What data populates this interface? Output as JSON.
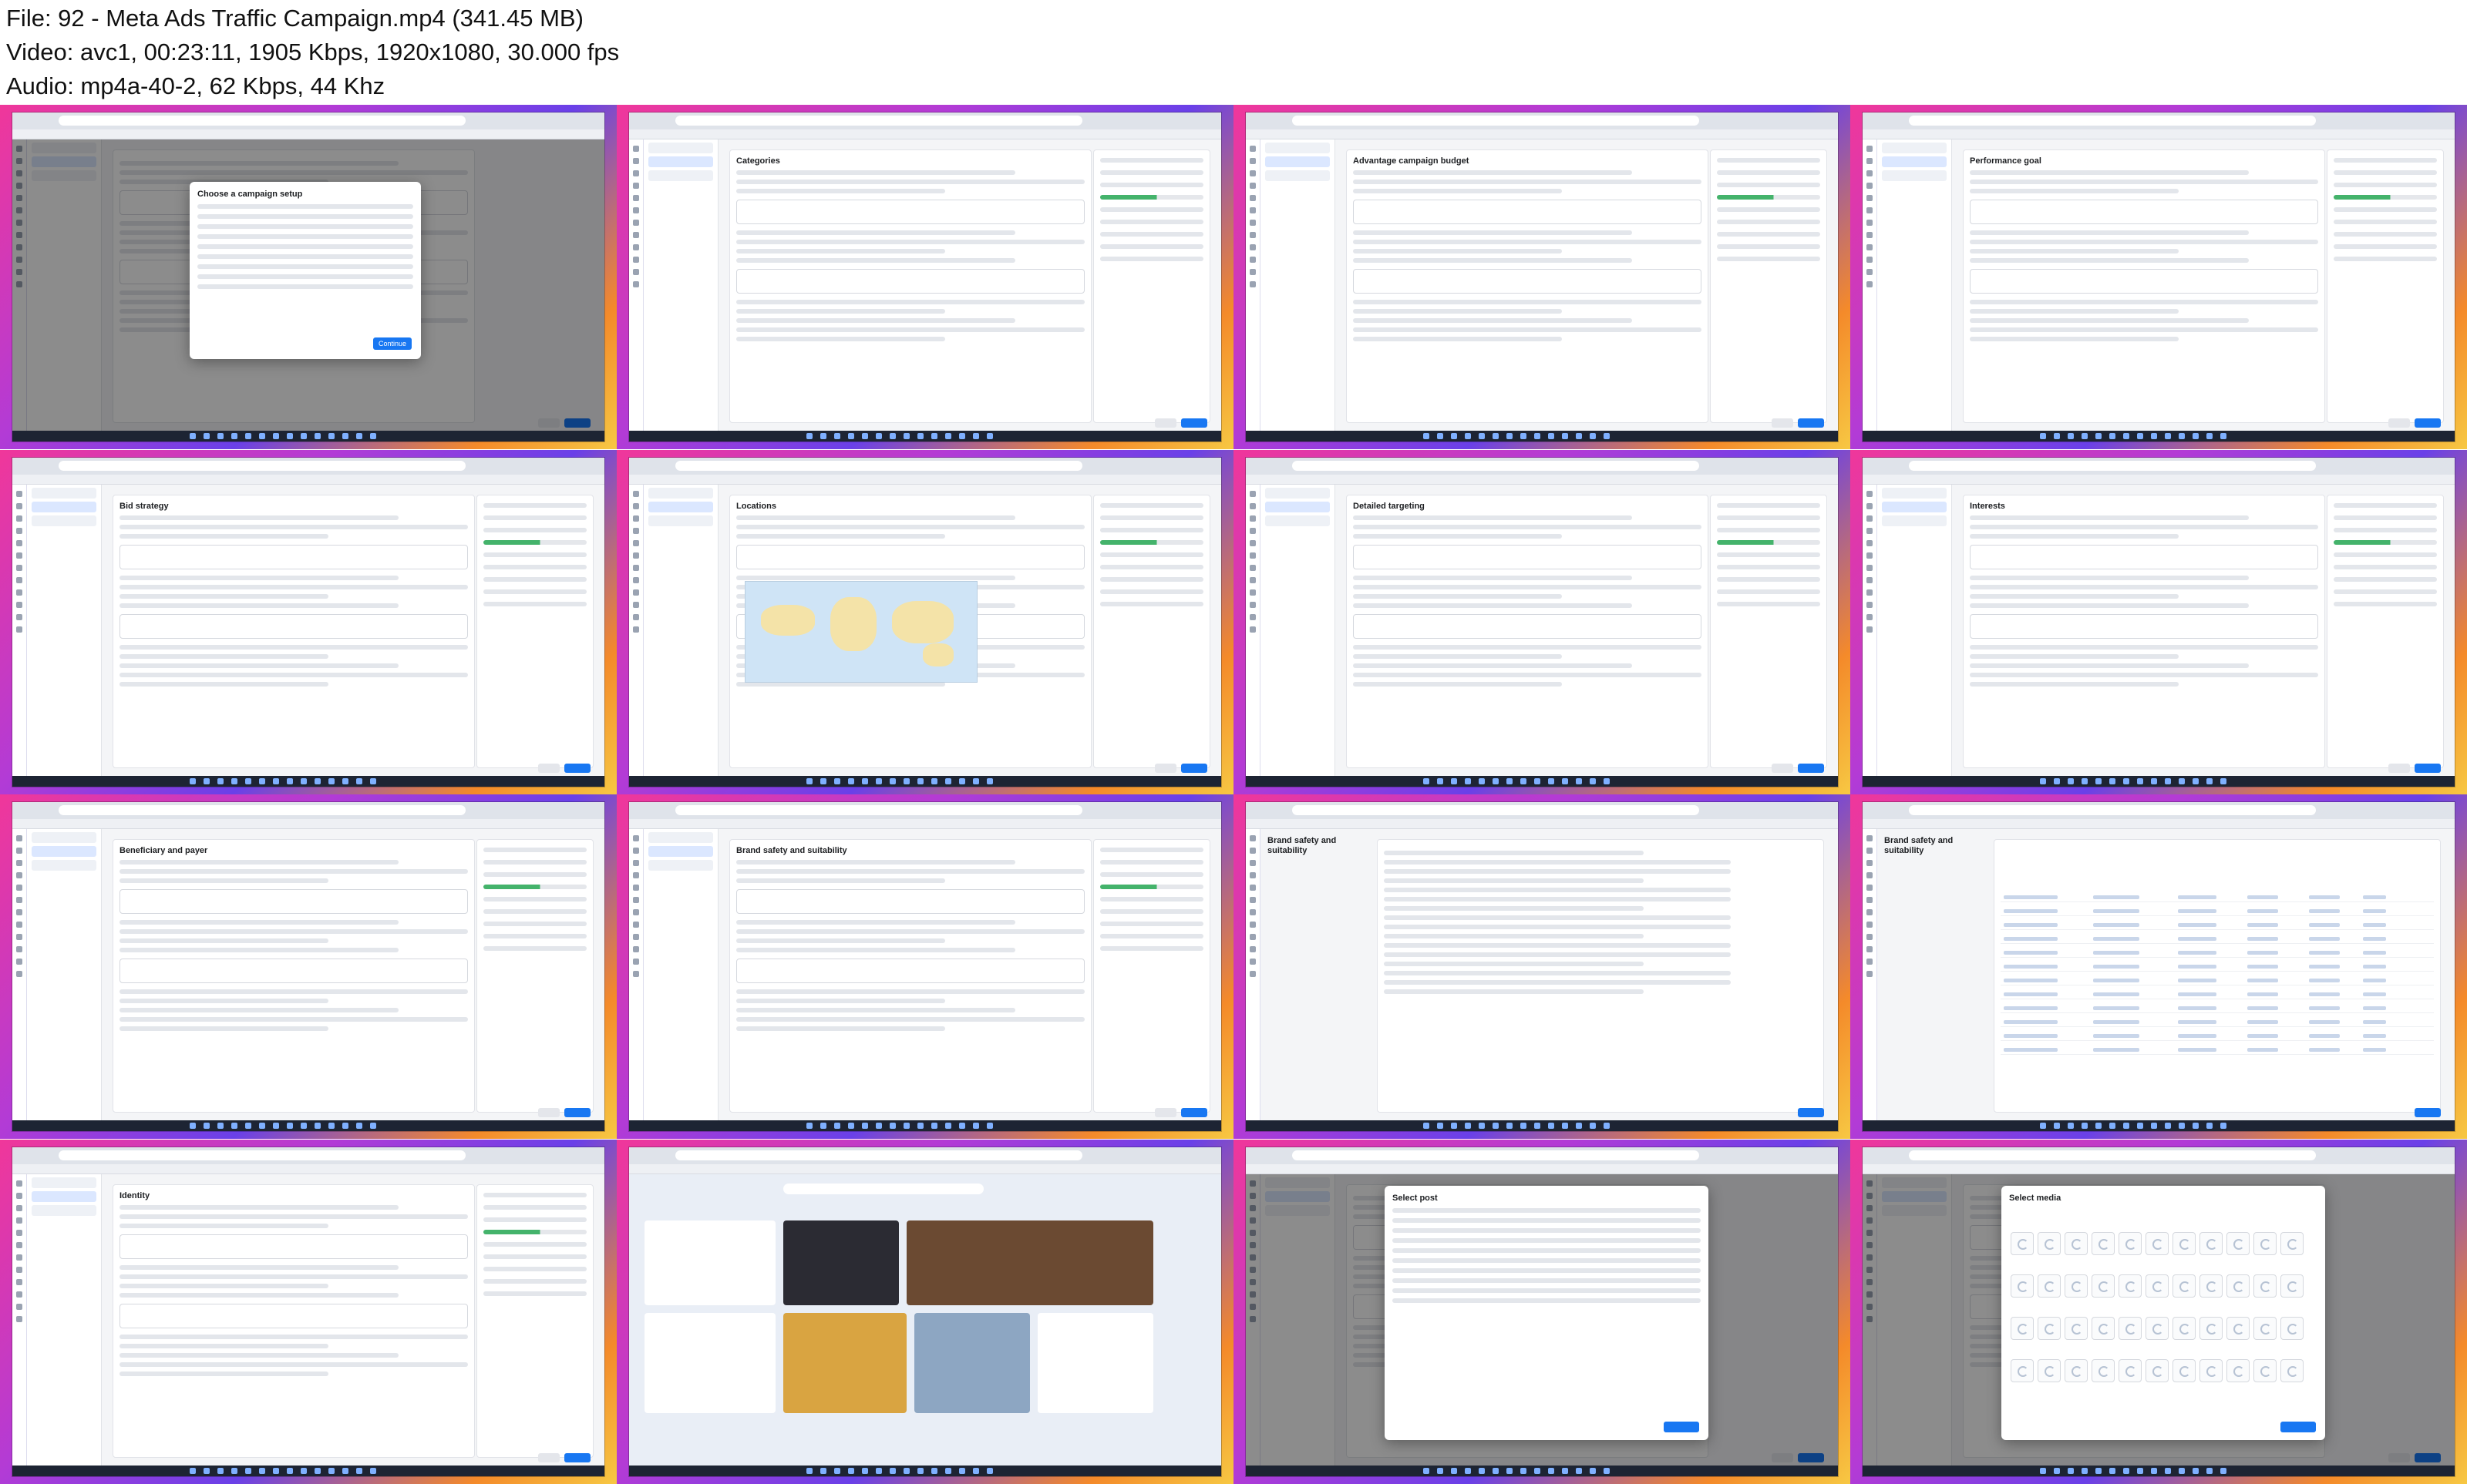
{
  "header": {
    "file_line": "File: 92 - Meta Ads Traffic Campaign.mp4 (341.45 MB)",
    "video_line": "Video: avc1, 00:23:11, 1905 Kbps, 1920x1080, 30.000 fps",
    "audio_line": "Audio: mp4a-40-2, 62 Kbps, 44 Khz"
  },
  "frames": [
    {
      "id": 1,
      "scene": "choose-campaign-setup-modal",
      "modal_title": "Choose a campaign setup",
      "primary_button": "Continue"
    },
    {
      "id": 2,
      "scene": "categories-dropdown",
      "section_title": "Categories"
    },
    {
      "id": 3,
      "scene": "advantage-campaign-budget",
      "section_title": "Advantage campaign budget"
    },
    {
      "id": 4,
      "scene": "performance-goal",
      "section_title": "Performance goal"
    },
    {
      "id": 5,
      "scene": "bid-strategy",
      "section_title": "Bid strategy"
    },
    {
      "id": 6,
      "scene": "locations-map",
      "section_title": "Locations"
    },
    {
      "id": 7,
      "scene": "detailed-targeting",
      "section_title": "Detailed targeting"
    },
    {
      "id": 8,
      "scene": "interests-browse",
      "section_title": "Interests"
    },
    {
      "id": 9,
      "scene": "beneficiary-and-payer",
      "section_title": "Beneficiary and payer"
    },
    {
      "id": 10,
      "scene": "brand-safety-suitability",
      "section_title": "Brand safety and suitability"
    },
    {
      "id": 11,
      "scene": "brand-safety-inventory",
      "page_title": "Brand safety and suitability"
    },
    {
      "id": 12,
      "scene": "publisher-lists",
      "page_title": "Brand safety and suitability"
    },
    {
      "id": 13,
      "scene": "identity-facebook-page",
      "section_title": "Identity"
    },
    {
      "id": 14,
      "scene": "microsoft-start-news"
    },
    {
      "id": 15,
      "scene": "select-post-modal",
      "modal_title": "Select post"
    },
    {
      "id": 16,
      "scene": "set-up-your-media",
      "modal_title": "Select media"
    }
  ]
}
